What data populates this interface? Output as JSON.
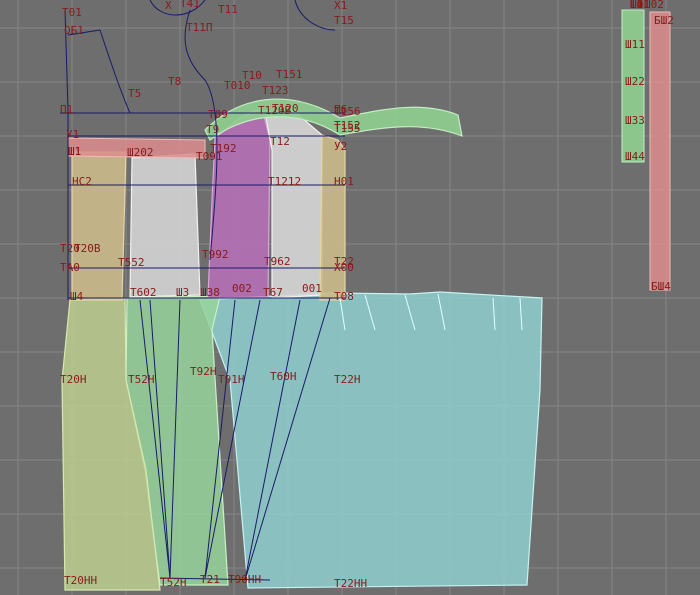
{
  "colors": {
    "background": "#6e6e6e",
    "grid": "#858585",
    "label": "#8a1a1a",
    "construction_line": "#1a1a66",
    "piece_yellow": "#cbb98a",
    "piece_white": "#d3d3d3",
    "piece_purple": "#b46fb4",
    "piece_green": "#8fcf8f",
    "piece_red": "#dd8d8d",
    "piece_cyan": "#8fcfcf",
    "piece_olive": "#bdcf8f"
  },
  "labels": [
    "Т01",
    "ОБ1",
    "Х",
    "Т41",
    "Т11",
    "Х1",
    "Т15",
    "Т11П",
    "Т5",
    "Т8",
    "Т010",
    "Т10",
    "Т151",
    "Т123",
    "П1",
    "Т9",
    "Т09",
    "Т120В",
    "Т120",
    "П6",
    "Т156",
    "Т155",
    "У1",
    "Т12",
    "Т152",
    "У2",
    "Ш1",
    "Ш1",
    "Ш202",
    "Т192",
    "Т091",
    "НС2",
    "Т1212",
    "Н01",
    "Т20",
    "Т20В",
    "Т552",
    "Т992",
    "Т962",
    "Т22",
    "ТА0",
    "Х00",
    "Ш4",
    "Т602",
    "Ш3",
    "Ш38",
    "002",
    "Т67",
    "001",
    "Т08",
    "Т20Н",
    "Т52Н",
    "Т92Н",
    "Т91Н",
    "Т60Н",
    "Т22Н",
    "Т20НН",
    "Т52Н",
    "Т21",
    "Т90НН",
    "Т22НН",
    "Ш11",
    "Ш22",
    "Ш33",
    "Ш44",
    "Ш0",
    "Ш1",
    "Ш2",
    "Ш3",
    "Ш4",
    "Ш01",
    "Ш02",
    "БШ2",
    "БШ4"
  ]
}
